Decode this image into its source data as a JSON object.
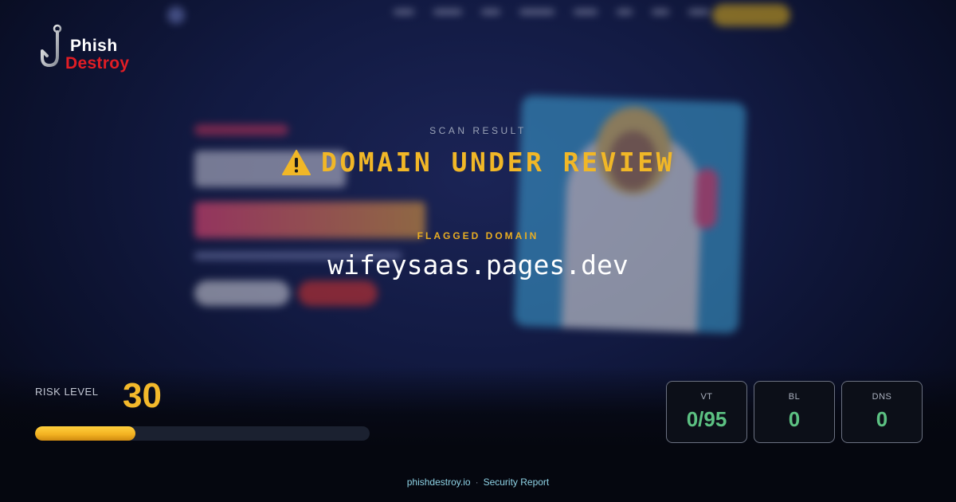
{
  "brand": {
    "name_line1": "Phish",
    "name_line2": "Destroy"
  },
  "scan": {
    "section_label": "SCAN RESULT",
    "status": "DOMAIN UNDER REVIEW",
    "status_icon": "warning-icon",
    "flagged_label": "FLAGGED DOMAIN",
    "domain": "wifeysaas.pages.dev"
  },
  "risk": {
    "label": "RISK LEVEL",
    "value": "30",
    "percent": 30
  },
  "stats": [
    {
      "label": "VT",
      "value": "0/95"
    },
    {
      "label": "BL",
      "value": "0"
    },
    {
      "label": "DNS",
      "value": "0"
    }
  ],
  "footer": {
    "site": "phishdestroy.io",
    "separator": "·",
    "report": "Security Report"
  },
  "colors": {
    "warning": "#f1b727",
    "risk": "#f3b92b",
    "safe": "#5cc182",
    "brand_red": "#e11d25"
  }
}
